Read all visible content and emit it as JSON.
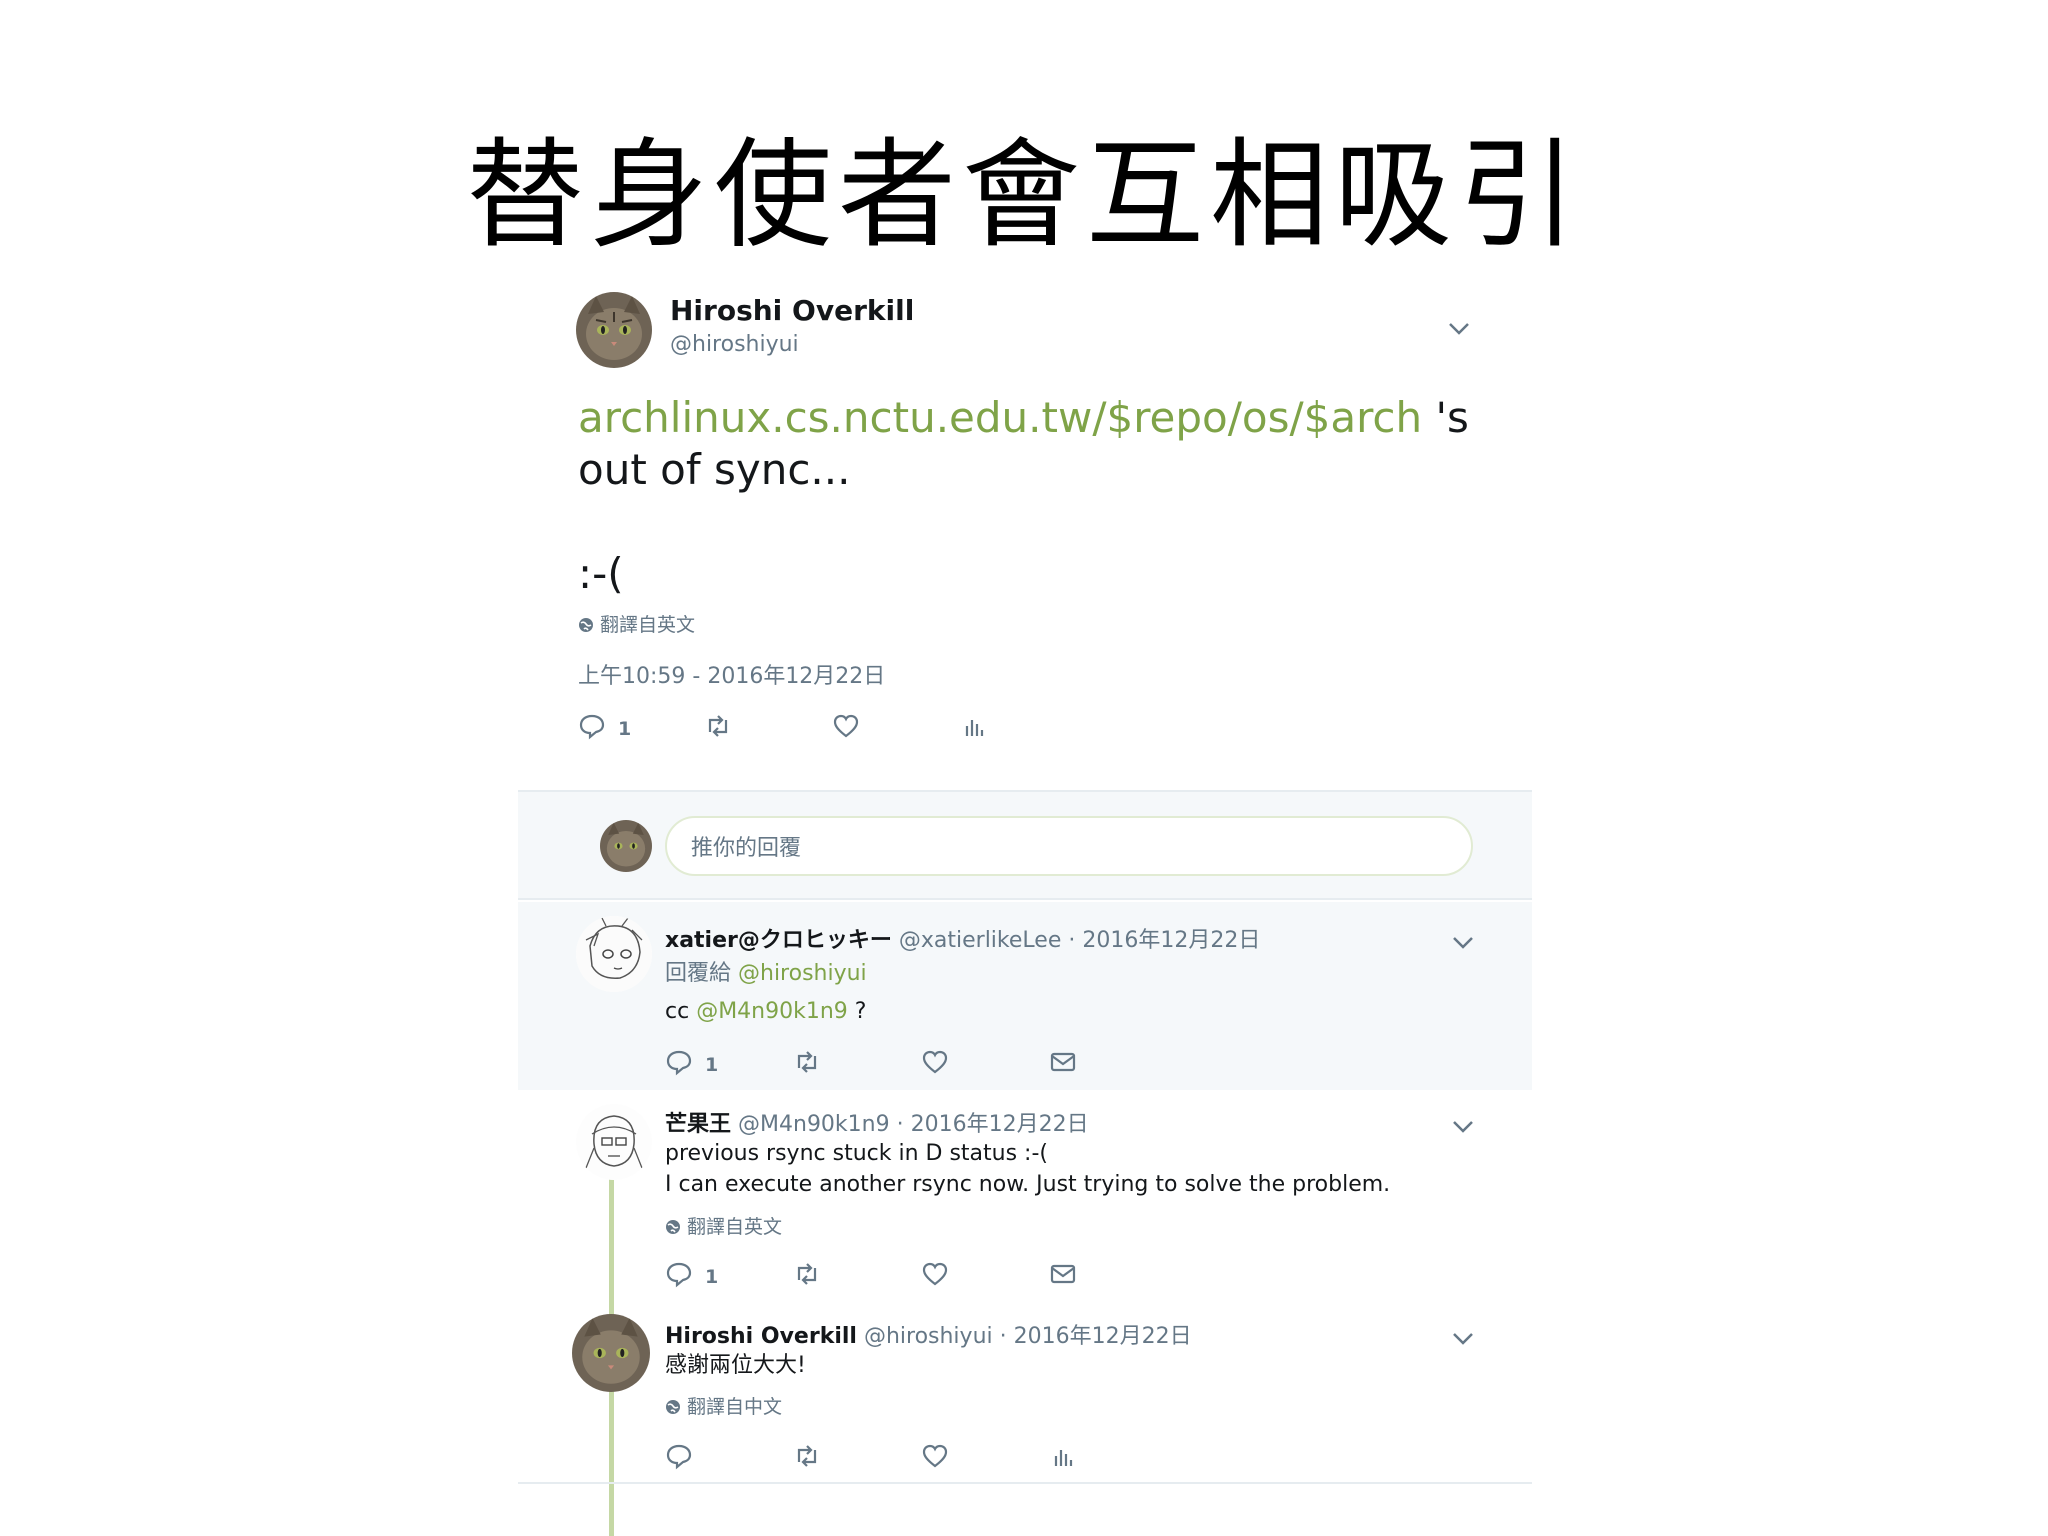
{
  "slide": {
    "title": "替身使者會互相吸引"
  },
  "main_tweet": {
    "author_name": "Hiroshi Overkill",
    "author_handle": "@hiroshiyui",
    "link_text": "archlinux.cs.nctu.edu.tw/$repo/os/$arch",
    "text_after_link": " 's",
    "line2": "out of sync...",
    "line3": ":-(",
    "translate_label": "翻譯自英文",
    "timestamp": "上午10:59 - 2016年12月22日",
    "reply_count": "1"
  },
  "reply_box": {
    "placeholder": "推你的回覆"
  },
  "replies": [
    {
      "name": "xatier@クロヒッキー",
      "handle": "@xatierlikeLee",
      "date": " · 2016年12月22日",
      "reply_to_label": "回覆給 ",
      "reply_to_handle": "@hiroshiyui",
      "text_prefix": "cc ",
      "mention": "@M4n90k1n9",
      "text_suffix": " ?",
      "reply_count": "1"
    },
    {
      "name": "芒果王",
      "handle": "@M4n90k1n9",
      "date": " · 2016年12月22日",
      "line1": "previous rsync stuck in D status :-(",
      "line2": "I can execute another rsync now. Just trying to solve the problem.",
      "translate_label": "翻譯自英文",
      "reply_count": "1"
    },
    {
      "name": "Hiroshi Overkill",
      "handle": "@hiroshiyui",
      "date": " · 2016年12月22日",
      "line1": "感謝兩位大大!",
      "translate_label": "翻譯自中文"
    }
  ],
  "colors": {
    "link": "#7fa348",
    "muted": "#657786",
    "thread": "#c5d8a5",
    "highlight_bg": "#f5f8fa"
  }
}
